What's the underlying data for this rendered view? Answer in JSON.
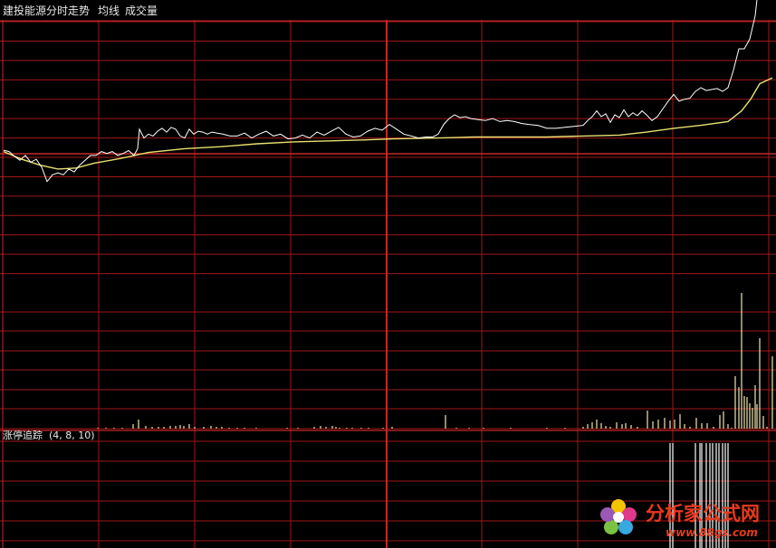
{
  "header": {
    "title": "建投能源分时走势",
    "legend_avg": "均线",
    "legend_vol": "成交量",
    "indicator_title": "涨停追踪",
    "indicator_params": "(4, 8, 10)"
  },
  "watermark": {
    "name": "分析家公式网",
    "url": "www.88gs.com"
  },
  "colors": {
    "background": "#000000",
    "grid": "#a01818",
    "grid_major": "#c42828",
    "price_line": "#ffffff",
    "avg_line": "#e8e070",
    "volume": "#f0e6b0",
    "indicator": "#ffffff"
  },
  "chart_data": [
    {
      "type": "line",
      "panel": "price",
      "series": [
        {
          "key": "price",
          "values": [
            [
              0,
              0.37
            ],
            [
              6,
              0.3
            ],
            [
              12,
              0.05
            ],
            [
              18,
              -0.15
            ],
            [
              24,
              0.1
            ],
            [
              30,
              -0.25
            ],
            [
              36,
              -0.1
            ],
            [
              42,
              -0.5
            ],
            [
              48,
              -1.25
            ],
            [
              54,
              -0.9
            ],
            [
              60,
              -0.8
            ],
            [
              66,
              -0.9
            ],
            [
              72,
              -0.6
            ],
            [
              78,
              -0.75
            ],
            [
              84,
              -0.4
            ],
            [
              90,
              -0.15
            ],
            [
              96,
              0.1
            ],
            [
              102,
              0.1
            ],
            [
              108,
              0.3
            ],
            [
              114,
              0.2
            ],
            [
              120,
              0.3
            ],
            [
              126,
              0.1
            ],
            [
              132,
              0.2
            ],
            [
              138,
              0.35
            ],
            [
              144,
              0.1
            ],
            [
              148,
              0.45
            ],
            [
              150,
              1.45
            ],
            [
              155,
              1.0
            ],
            [
              160,
              1.2
            ],
            [
              165,
              1.1
            ],
            [
              170,
              1.35
            ],
            [
              175,
              1.5
            ],
            [
              180,
              1.3
            ],
            [
              185,
              1.55
            ],
            [
              190,
              1.45
            ],
            [
              195,
              1.1
            ],
            [
              200,
              1.0
            ],
            [
              205,
              1.45
            ],
            [
              210,
              1.2
            ],
            [
              215,
              1.35
            ],
            [
              220,
              1.3
            ],
            [
              225,
              1.2
            ],
            [
              230,
              1.3
            ],
            [
              236,
              1.25
            ],
            [
              242,
              1.2
            ],
            [
              250,
              1.1
            ],
            [
              258,
              1.1
            ],
            [
              266,
              1.25
            ],
            [
              274,
              1.0
            ],
            [
              282,
              1.2
            ],
            [
              290,
              1.35
            ],
            [
              298,
              1.1
            ],
            [
              306,
              1.2
            ],
            [
              314,
              0.95
            ],
            [
              322,
              1.0
            ],
            [
              330,
              1.15
            ],
            [
              338,
              1.0
            ],
            [
              346,
              1.3
            ],
            [
              354,
              1.15
            ],
            [
              362,
              1.35
            ],
            [
              370,
              1.55
            ],
            [
              378,
              1.2
            ],
            [
              386,
              1.05
            ],
            [
              394,
              1.1
            ],
            [
              402,
              1.35
            ],
            [
              410,
              1.5
            ],
            [
              418,
              1.4
            ],
            [
              426,
              1.7
            ],
            [
              434,
              1.45
            ],
            [
              442,
              1.2
            ],
            [
              450,
              1.1
            ],
            [
              458,
              1.0
            ],
            [
              466,
              1.05
            ],
            [
              474,
              1.05
            ],
            [
              480,
              1.2
            ],
            [
              486,
              1.7
            ],
            [
              492,
              2.0
            ],
            [
              498,
              2.2
            ],
            [
              504,
              2.05
            ],
            [
              510,
              2.1
            ],
            [
              516,
              2.0
            ],
            [
              524,
              1.95
            ],
            [
              532,
              1.9
            ],
            [
              540,
              2.0
            ],
            [
              548,
              1.85
            ],
            [
              556,
              1.9
            ],
            [
              564,
              1.85
            ],
            [
              572,
              1.75
            ],
            [
              580,
              1.7
            ],
            [
              590,
              1.65
            ],
            [
              600,
              1.5
            ],
            [
              610,
              1.5
            ],
            [
              620,
              1.55
            ],
            [
              630,
              1.6
            ],
            [
              640,
              1.65
            ],
            [
              645,
              1.9
            ],
            [
              650,
              2.1
            ],
            [
              655,
              2.4
            ],
            [
              660,
              2.1
            ],
            [
              665,
              2.25
            ],
            [
              670,
              1.8
            ],
            [
              675,
              2.2
            ],
            [
              680,
              2.05
            ],
            [
              685,
              2.45
            ],
            [
              690,
              2.1
            ],
            [
              695,
              2.3
            ],
            [
              700,
              2.15
            ],
            [
              705,
              2.4
            ],
            [
              710,
              2.2
            ],
            [
              716,
              1.9
            ],
            [
              722,
              2.1
            ],
            [
              728,
              2.5
            ],
            [
              734,
              2.9
            ],
            [
              740,
              3.25
            ],
            [
              746,
              2.9
            ],
            [
              752,
              3.0
            ],
            [
              758,
              3.05
            ],
            [
              764,
              3.4
            ],
            [
              770,
              3.6
            ],
            [
              776,
              3.45
            ],
            [
              782,
              3.5
            ],
            [
              788,
              3.55
            ],
            [
              794,
              3.4
            ],
            [
              800,
              3.6
            ],
            [
              806,
              4.5
            ],
            [
              812,
              5.6
            ],
            [
              818,
              5.6
            ],
            [
              824,
              6.1
            ],
            [
              830,
              7.3
            ],
            [
              834,
              9.0
            ],
            [
              837,
              11.0
            ],
            [
              840,
              10.0
            ],
            [
              843,
              8.6
            ],
            [
              846,
              9.2
            ],
            [
              849,
              10.5
            ]
          ]
        },
        {
          "key": "average",
          "values": [
            [
              0,
              0.3
            ],
            [
              20,
              -0.1
            ],
            [
              40,
              -0.4
            ],
            [
              60,
              -0.6
            ],
            [
              80,
              -0.55
            ],
            [
              100,
              -0.3
            ],
            [
              130,
              -0.05
            ],
            [
              160,
              0.25
            ],
            [
              200,
              0.45
            ],
            [
              240,
              0.55
            ],
            [
              280,
              0.7
            ],
            [
              320,
              0.8
            ],
            [
              360,
              0.85
            ],
            [
              400,
              0.9
            ],
            [
              430,
              0.95
            ],
            [
              480,
              1.0
            ],
            [
              520,
              1.05
            ],
            [
              560,
              1.05
            ],
            [
              600,
              1.05
            ],
            [
              640,
              1.1
            ],
            [
              680,
              1.15
            ],
            [
              710,
              1.3
            ],
            [
              740,
              1.5
            ],
            [
              770,
              1.65
            ],
            [
              800,
              1.85
            ],
            [
              815,
              2.4
            ],
            [
              825,
              3.0
            ],
            [
              835,
              3.8
            ],
            [
              849,
              4.1
            ]
          ]
        }
      ]
    },
    {
      "type": "bar",
      "panel": "volume",
      "series": [
        {
          "key": "volume",
          "values": [
            [
              104,
              1
            ],
            [
              113,
              1
            ],
            [
              122,
              1
            ],
            [
              131,
              1
            ],
            [
              143,
              5
            ],
            [
              149,
              10
            ],
            [
              157,
              3
            ],
            [
              164,
              2
            ],
            [
              171,
              2
            ],
            [
              177,
              2
            ],
            [
              184,
              3
            ],
            [
              190,
              3
            ],
            [
              195,
              4
            ],
            [
              199,
              3
            ],
            [
              205,
              5
            ],
            [
              211,
              2
            ],
            [
              221,
              2
            ],
            [
              229,
              3
            ],
            [
              235,
              2
            ],
            [
              241,
              2
            ],
            [
              249,
              1
            ],
            [
              258,
              1
            ],
            [
              266,
              1
            ],
            [
              279,
              1
            ],
            [
              313,
              1
            ],
            [
              325,
              1
            ],
            [
              343,
              2
            ],
            [
              350,
              3
            ],
            [
              356,
              2
            ],
            [
              363,
              3
            ],
            [
              367,
              2
            ],
            [
              371,
              1
            ],
            [
              379,
              1
            ],
            [
              385,
              1
            ],
            [
              395,
              1
            ],
            [
              403,
              1
            ],
            [
              419,
              1
            ],
            [
              429,
              2
            ],
            [
              488,
              15
            ],
            [
              500,
              1
            ],
            [
              514,
              1
            ],
            [
              530,
              1
            ],
            [
              560,
              1
            ],
            [
              600,
              1
            ],
            [
              620,
              1
            ],
            [
              640,
              2
            ],
            [
              645,
              5
            ],
            [
              650,
              7
            ],
            [
              655,
              10
            ],
            [
              660,
              6
            ],
            [
              665,
              3
            ],
            [
              670,
              2
            ],
            [
              677,
              7
            ],
            [
              683,
              5
            ],
            [
              687,
              6
            ],
            [
              693,
              4
            ],
            [
              700,
              2
            ],
            [
              711,
              20
            ],
            [
              717,
              8
            ],
            [
              723,
              10
            ],
            [
              730,
              12
            ],
            [
              736,
              9
            ],
            [
              741,
              10
            ],
            [
              747,
              16
            ],
            [
              752,
              5
            ],
            [
              758,
              2
            ],
            [
              765,
              12
            ],
            [
              771,
              6
            ],
            [
              777,
              6
            ],
            [
              784,
              2
            ],
            [
              791,
              15
            ],
            [
              795,
              19
            ],
            [
              800,
              5
            ],
            [
              804,
              1
            ],
            [
              808,
              58
            ],
            [
              812,
              46
            ],
            [
              815,
              150
            ],
            [
              818,
              36
            ],
            [
              821,
              35
            ],
            [
              824,
              28
            ],
            [
              827,
              23
            ],
            [
              830,
              48
            ],
            [
              832,
              27
            ],
            [
              835,
              100
            ],
            [
              839,
              14
            ],
            [
              843,
              2
            ],
            [
              849,
              80
            ]
          ]
        }
      ]
    },
    {
      "type": "bar",
      "panel": "indicator",
      "series": [
        {
          "key": "indicator",
          "values": [
            [
              736,
              1
            ],
            [
              739,
              1
            ],
            [
              764,
              1
            ],
            [
              769,
              1
            ],
            [
              771,
              1
            ],
            [
              776,
              1
            ],
            [
              780,
              1
            ],
            [
              783,
              1
            ],
            [
              787,
              1
            ],
            [
              790,
              1
            ],
            [
              794,
              1
            ],
            [
              797,
              1
            ],
            [
              800,
              1
            ]
          ]
        }
      ]
    }
  ]
}
